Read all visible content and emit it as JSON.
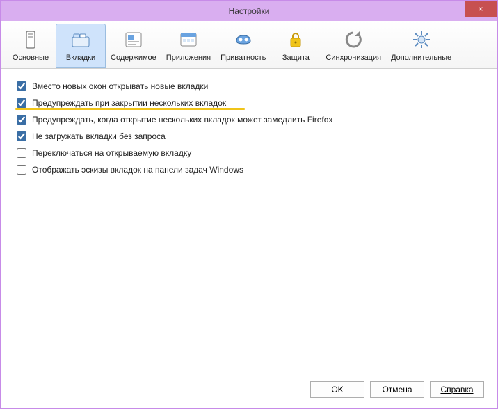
{
  "window": {
    "title": "Настройки",
    "close_icon": "×"
  },
  "toolbar": {
    "items": [
      {
        "id": "general",
        "label": "Основные",
        "icon": "general-icon",
        "active": false
      },
      {
        "id": "tabs",
        "label": "Вкладки",
        "icon": "tabs-icon",
        "active": true
      },
      {
        "id": "content",
        "label": "Содержимое",
        "icon": "content-icon",
        "active": false
      },
      {
        "id": "apps",
        "label": "Приложения",
        "icon": "apps-icon",
        "active": false
      },
      {
        "id": "privacy",
        "label": "Приватность",
        "icon": "privacy-icon",
        "active": false
      },
      {
        "id": "security",
        "label": "Защита",
        "icon": "security-icon",
        "active": false
      },
      {
        "id": "sync",
        "label": "Синхронизация",
        "icon": "sync-icon",
        "active": false
      },
      {
        "id": "advanced",
        "label": "Дополнительные",
        "icon": "advanced-icon",
        "active": false
      }
    ]
  },
  "options": [
    {
      "checked": true,
      "highlight": false,
      "label": "Вместо новых окон открывать новые вкладки"
    },
    {
      "checked": true,
      "highlight": true,
      "label": "Предупреждать при закрытии нескольких вкладок"
    },
    {
      "checked": true,
      "highlight": false,
      "label": "Предупреждать, когда открытие нескольких вкладок может замедлить Firefox"
    },
    {
      "checked": true,
      "highlight": false,
      "label": "Не загружать вкладки без запроса"
    },
    {
      "checked": false,
      "highlight": false,
      "label": "Переключаться на открываемую вкладку"
    },
    {
      "checked": false,
      "highlight": false,
      "label": "Отображать эскизы вкладок на панели задач Windows"
    }
  ],
  "footer": {
    "ok": "OK",
    "cancel": "Отмена",
    "help": "Справка"
  }
}
